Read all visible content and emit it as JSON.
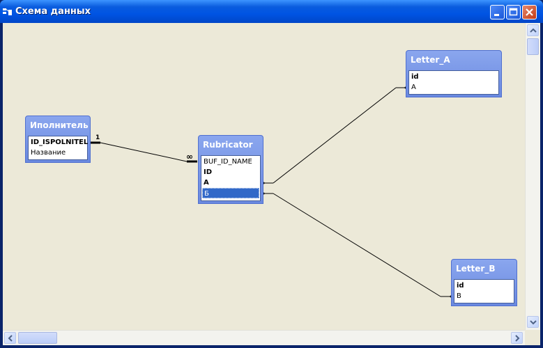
{
  "window": {
    "title": "Схема данных"
  },
  "titlebar_buttons": [
    {
      "name": "minimize-button",
      "icon": "minimize-icon"
    },
    {
      "name": "maximize-button",
      "icon": "maximize-icon"
    },
    {
      "name": "close-button",
      "icon": "close-icon"
    }
  ],
  "tables": [
    {
      "title": "Иполнитель",
      "fields": [
        {
          "label": "ID_ISPOLNITEL",
          "key": true
        },
        {
          "label": "Название",
          "key": false
        }
      ]
    },
    {
      "title": "Rubricator",
      "fields": [
        {
          "label": "BUF_ID_NAME",
          "key": false
        },
        {
          "label": "ID",
          "key": true
        },
        {
          "label": "A",
          "key": true
        },
        {
          "label": "Б",
          "key": false,
          "selected": true
        }
      ]
    },
    {
      "title": "Letter_A",
      "fields": [
        {
          "label": "id",
          "key": true
        },
        {
          "label": "A",
          "key": false
        }
      ]
    },
    {
      "title": "Letter_B",
      "fields": [
        {
          "label": "id",
          "key": true
        },
        {
          "label": "B",
          "key": false
        }
      ]
    }
  ],
  "relationships": [
    {
      "from": "Иполнитель.ID_ISPOLNITEL",
      "to": "Rubricator.BUF_ID_NAME",
      "one": "1",
      "many": "∞"
    },
    {
      "from": "Rubricator.A",
      "to": "Letter_A.A"
    },
    {
      "from": "Rubricator.Б",
      "to": "Letter_B.B"
    }
  ],
  "colors": {
    "titlebar": "#0054e3",
    "table_header": "#7b97e8",
    "canvas": "#ece9d8",
    "selection": "#3168c8"
  }
}
